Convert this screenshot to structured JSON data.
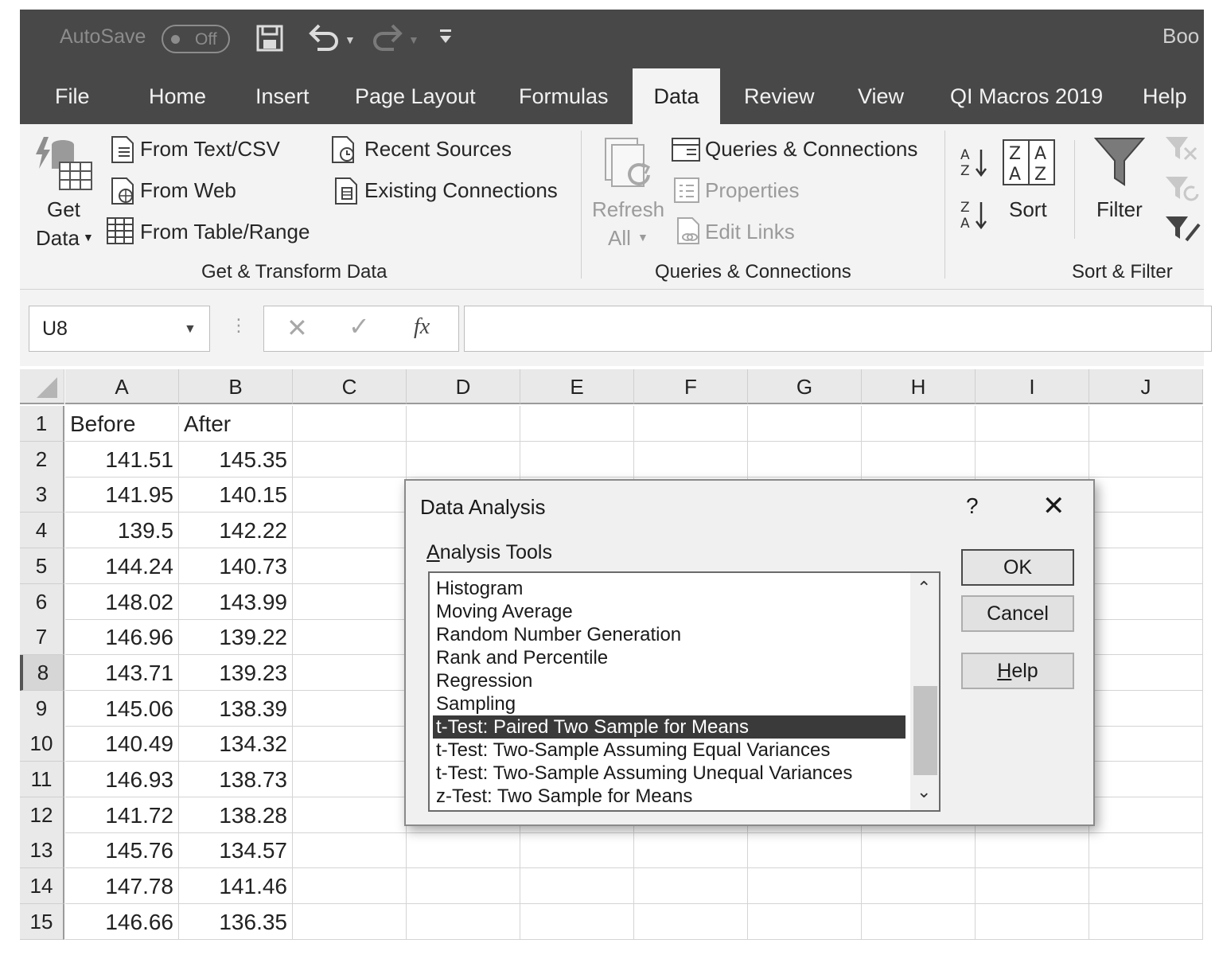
{
  "titlebar": {
    "autosave_label": "AutoSave",
    "autosave_state": "Off",
    "book_title": "Boo"
  },
  "tabs": [
    {
      "label": "File"
    },
    {
      "label": "Home"
    },
    {
      "label": "Insert"
    },
    {
      "label": "Page Layout"
    },
    {
      "label": "Formulas"
    },
    {
      "label": "Data",
      "active": true
    },
    {
      "label": "Review"
    },
    {
      "label": "View"
    },
    {
      "label": "QI Macros 2019"
    },
    {
      "label": "Help"
    }
  ],
  "ribbon": {
    "get_data_line1": "Get",
    "get_data_line2": "Data",
    "from_text_csv": "From Text/CSV",
    "from_web": "From Web",
    "from_table_range": "From Table/Range",
    "recent_sources": "Recent Sources",
    "existing_connections": "Existing Connections",
    "group_get_transform": "Get & Transform Data",
    "refresh_line1": "Refresh",
    "refresh_line2": "All",
    "queries_connections": "Queries & Connections",
    "properties": "Properties",
    "edit_links": "Edit Links",
    "group_queries": "Queries & Connections",
    "sort": "Sort",
    "filter": "Filter",
    "group_sort_filter": "Sort & Filter"
  },
  "formula_bar": {
    "name_box": "U8",
    "fx": "fx",
    "formula": ""
  },
  "columns": [
    "A",
    "B",
    "C",
    "D",
    "E",
    "F",
    "G",
    "H",
    "I",
    "J"
  ],
  "selected_row": 8,
  "rows": [
    {
      "n": "1",
      "a": "Before",
      "b": "After"
    },
    {
      "n": "2",
      "a": "141.51",
      "b": "145.35"
    },
    {
      "n": "3",
      "a": "141.95",
      "b": "140.15"
    },
    {
      "n": "4",
      "a": "139.5",
      "b": "142.22"
    },
    {
      "n": "5",
      "a": "144.24",
      "b": "140.73"
    },
    {
      "n": "6",
      "a": "148.02",
      "b": "143.99"
    },
    {
      "n": "7",
      "a": "146.96",
      "b": "139.22"
    },
    {
      "n": "8",
      "a": "143.71",
      "b": "139.23"
    },
    {
      "n": "9",
      "a": "145.06",
      "b": "138.39"
    },
    {
      "n": "10",
      "a": "140.49",
      "b": "134.32"
    },
    {
      "n": "11",
      "a": "146.93",
      "b": "138.73"
    },
    {
      "n": "12",
      "a": "141.72",
      "b": "138.28"
    },
    {
      "n": "13",
      "a": "145.76",
      "b": "134.57"
    },
    {
      "n": "14",
      "a": "147.78",
      "b": "141.46"
    },
    {
      "n": "15",
      "a": "146.66",
      "b": "136.35"
    }
  ],
  "dialog": {
    "title": "Data Analysis",
    "help_glyph": "?",
    "tools_label_first": "A",
    "tools_label_rest": "nalysis Tools",
    "tools": [
      "Histogram",
      "Moving Average",
      "Random Number Generation",
      "Rank and Percentile",
      "Regression",
      "Sampling",
      "t-Test: Paired Two Sample for Means",
      "t-Test: Two-Sample Assuming Equal Variances",
      "t-Test: Two-Sample Assuming Unequal Variances",
      "z-Test: Two Sample for Means"
    ],
    "selected_tool": "t-Test: Paired Two Sample for Means",
    "ok": "OK",
    "cancel": "Cancel",
    "help_first": "H",
    "help_rest": "elp"
  }
}
